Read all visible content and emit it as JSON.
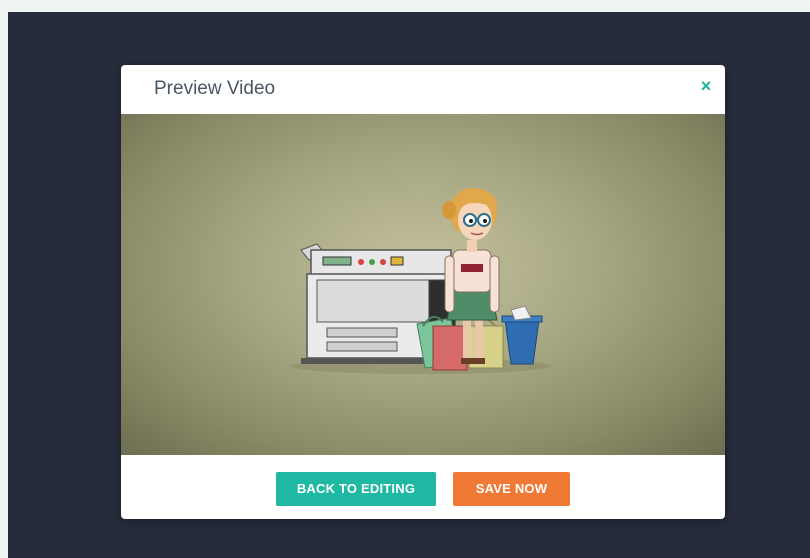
{
  "modal": {
    "title": "Preview Video",
    "close_symbol": "×"
  },
  "video": {
    "scene": "illustration-woman-with-shopping-bags-beside-office-copier"
  },
  "footer": {
    "back_label": "BACK TO EDITING",
    "save_label": "SAVE NOW"
  },
  "colors": {
    "overlay": "#272c3c",
    "accent_teal": "#1fb8a2",
    "accent_orange": "#f07a35",
    "title_text": "#4a5565"
  },
  "icons": {
    "close": "close-icon"
  }
}
